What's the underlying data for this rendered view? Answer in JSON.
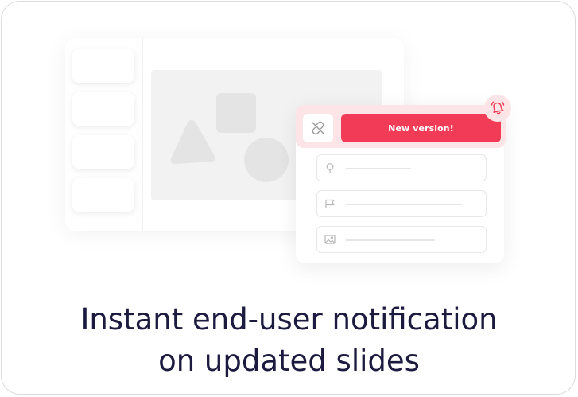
{
  "notification": {
    "button_label": "New version!",
    "unlink_icon": "unlink-icon",
    "bell_icon": "bell-ringing-icon"
  },
  "fields": [
    {
      "icon": "map-pin-icon"
    },
    {
      "icon": "flag-icon"
    },
    {
      "icon": "image-icon"
    }
  ],
  "caption": {
    "line1": "Instant end-user notification",
    "line2": "on updated slides"
  },
  "colors": {
    "accent": "#f23c57",
    "accent_light": "#fde4e7",
    "text_dark": "#1c1a3f"
  }
}
